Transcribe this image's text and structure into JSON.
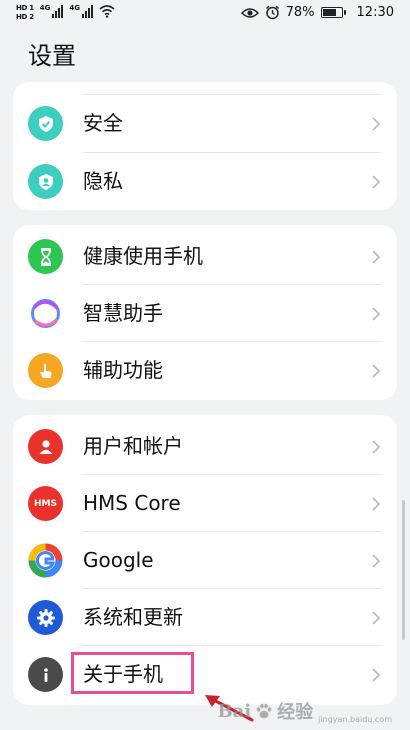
{
  "status_bar": {
    "sim1": "HD 1",
    "sim2": "HD 2",
    "net1": "4G",
    "net2": "4G",
    "battery_percent": "78%",
    "battery_level": 0.78,
    "time": "12:30",
    "icons": [
      "signal-icon",
      "wifi-icon",
      "eye-icon",
      "alarm-icon",
      "battery-icon"
    ]
  },
  "page": {
    "title": "设置"
  },
  "groups": [
    {
      "items": [
        {
          "label": "安全",
          "icon": "shield-icon",
          "color": "#3ccfc0"
        },
        {
          "label": "隐私",
          "icon": "privacy-icon",
          "color": "#3ccfc0"
        }
      ]
    },
    {
      "items": [
        {
          "label": "健康使用手机",
          "icon": "hourglass-icon",
          "color": "#2dc653"
        },
        {
          "label": "智慧助手",
          "icon": "ai-assistant-icon",
          "color": "#9a5cf2"
        },
        {
          "label": "辅助功能",
          "icon": "hand-icon",
          "color": "#f5a623"
        }
      ]
    },
    {
      "items": [
        {
          "label": "用户和帐户",
          "icon": "user-icon",
          "color": "#e8322b"
        },
        {
          "label": "HMS Core",
          "icon": "hms-icon",
          "color": "#e8322b",
          "icon_text": "HMS"
        },
        {
          "label": "Google",
          "icon": "google-icon",
          "color": "#4285f4"
        },
        {
          "label": "系统和更新",
          "icon": "gear-icon",
          "color": "#1f5bd8"
        },
        {
          "label": "关于手机",
          "icon": "info-icon",
          "color": "#4a4a4a"
        }
      ]
    }
  ],
  "annotation": {
    "highlight_color": "#e84d9a",
    "arrow_color": "#c8232c"
  },
  "watermark": {
    "brand_prefix": "Bai",
    "brand_suffix": "经验",
    "domain": "jingyan.baidu.com"
  }
}
